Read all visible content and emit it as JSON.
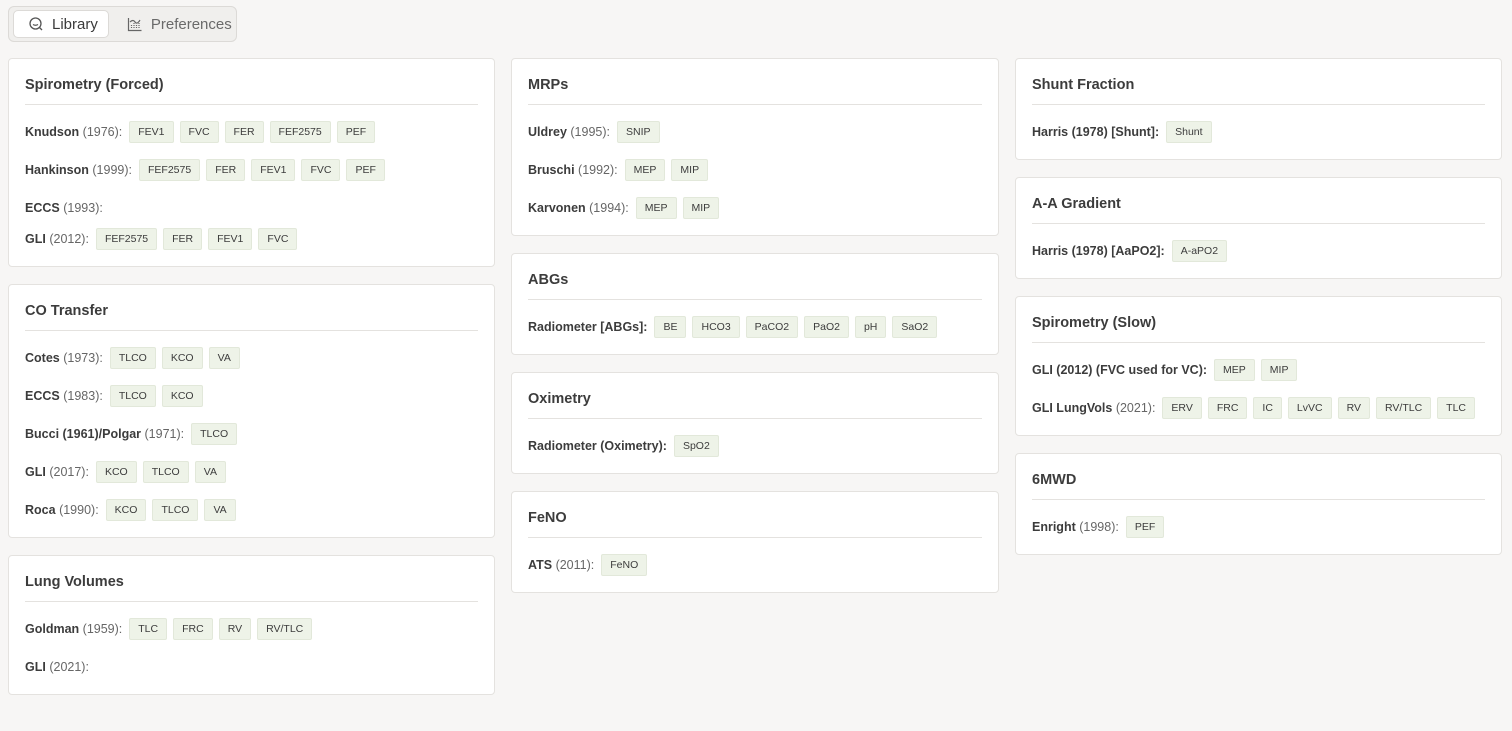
{
  "tabs": [
    {
      "label": "Library",
      "icon": "library-search-icon",
      "active": true
    },
    {
      "label": "Preferences",
      "icon": "preferences-chart-icon",
      "active": false
    }
  ],
  "colors": {
    "chip_bg": "#eef3e8",
    "page_bg": "#f7f6f5",
    "card_bg": "#ffffff"
  },
  "columns": [
    [
      {
        "title": "Spirometry (Forced)",
        "rows": [
          {
            "name": "Knudson",
            "year": "(1976):",
            "chips": [
              "FEV1",
              "FVC",
              "FER",
              "FEF2575",
              "PEF"
            ]
          },
          {
            "name": "Hankinson",
            "year": "(1999):",
            "chips": [
              "FEF2575",
              "FER",
              "FEV1",
              "FVC",
              "PEF"
            ]
          },
          {
            "name": "ECCS",
            "year": "(1993):",
            "chips": []
          },
          {
            "name": "GLI",
            "year": "(2012):",
            "chips": [
              "FEF2575",
              "FER",
              "FEV1",
              "FVC"
            ]
          }
        ]
      },
      {
        "title": "CO Transfer",
        "rows": [
          {
            "name": "Cotes",
            "year": "(1973):",
            "chips": [
              "TLCO",
              "KCO",
              "VA"
            ]
          },
          {
            "name": "ECCS",
            "year": "(1983):",
            "chips": [
              "TLCO",
              "KCO"
            ]
          },
          {
            "name": "Bucci (1961)/Polgar",
            "year": "(1971):",
            "chips": [
              "TLCO"
            ]
          },
          {
            "name": "GLI",
            "year": "(2017):",
            "chips": [
              "KCO",
              "TLCO",
              "VA"
            ]
          },
          {
            "name": "Roca",
            "year": "(1990):",
            "chips": [
              "KCO",
              "TLCO",
              "VA"
            ]
          }
        ]
      },
      {
        "title": "Lung Volumes",
        "rows": [
          {
            "name": "Goldman",
            "year": "(1959):",
            "chips": [
              "TLC",
              "FRC",
              "RV",
              "RV/TLC"
            ]
          },
          {
            "name": "GLI",
            "year": "(2021):",
            "chips": []
          }
        ]
      }
    ],
    [
      {
        "title": "MRPs",
        "rows": [
          {
            "name": "Uldrey",
            "year": "(1995):",
            "chips": [
              "SNIP"
            ]
          },
          {
            "name": "Bruschi",
            "year": "(1992):",
            "chips": [
              "MEP",
              "MIP"
            ]
          },
          {
            "name": "Karvonen",
            "year": "(1994):",
            "chips": [
              "MEP",
              "MIP"
            ]
          }
        ]
      },
      {
        "title": "ABGs",
        "rows": [
          {
            "name": "Radiometer [ABGs]:",
            "year": "",
            "chips": [
              "BE",
              "HCO3",
              "PaCO2",
              "PaO2",
              "pH",
              "SaO2"
            ]
          }
        ]
      },
      {
        "title": "Oximetry",
        "rows": [
          {
            "name": "Radiometer (Oximetry):",
            "year": "",
            "chips": [
              "SpO2"
            ]
          }
        ]
      },
      {
        "title": "FeNO",
        "rows": [
          {
            "name": "ATS",
            "year": "(2011):",
            "chips": [
              "FeNO"
            ]
          }
        ]
      }
    ],
    [
      {
        "title": "Shunt Fraction",
        "rows": [
          {
            "name": "Harris (1978) [Shunt]:",
            "year": "",
            "chips": [
              "Shunt"
            ]
          }
        ]
      },
      {
        "title": "A-A Gradient",
        "rows": [
          {
            "name": "Harris (1978) [AaPO2]:",
            "year": "",
            "chips": [
              "A-aPO2"
            ]
          }
        ]
      },
      {
        "title": "Spirometry (Slow)",
        "rows": [
          {
            "name": "GLI (2012) (FVC used for VC):",
            "year": "",
            "chips": [
              "MEP",
              "MIP"
            ]
          },
          {
            "name": "GLI LungVols",
            "year": "(2021):",
            "chips": [
              "ERV",
              "FRC",
              "IC",
              "LvVC",
              "RV",
              "RV/TLC",
              "TLC"
            ]
          }
        ]
      },
      {
        "title": "6MWD",
        "rows": [
          {
            "name": "Enright",
            "year": "(1998):",
            "chips": [
              "PEF"
            ]
          }
        ]
      }
    ]
  ]
}
